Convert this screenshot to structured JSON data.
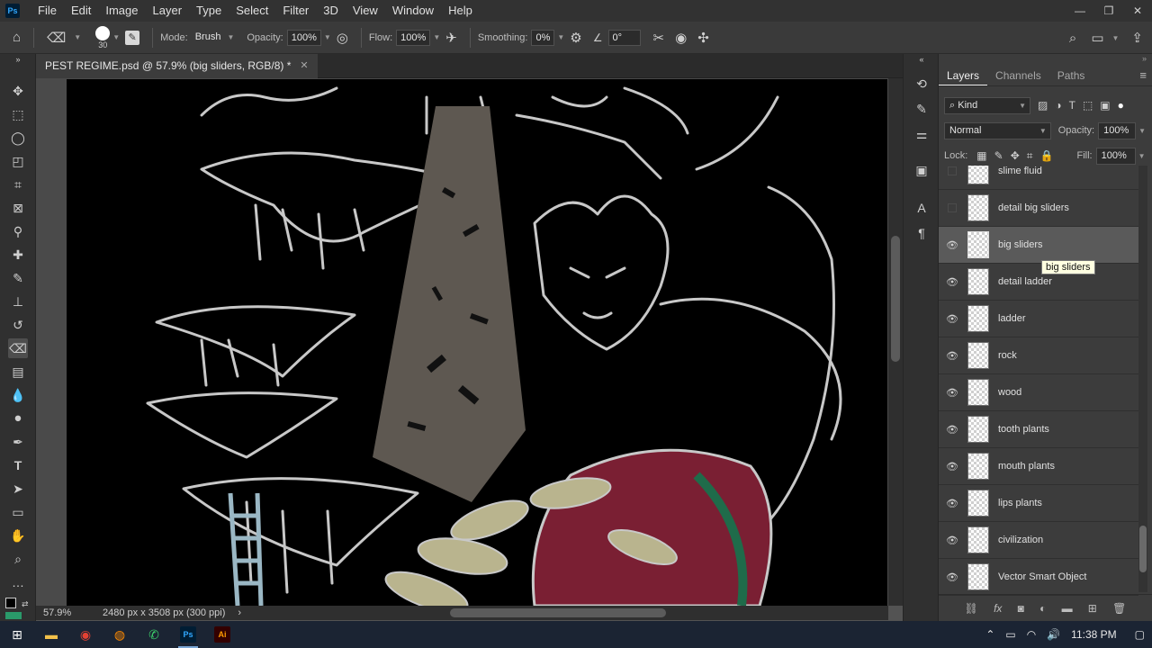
{
  "app": {
    "logo": "Ps"
  },
  "menu": [
    "File",
    "Edit",
    "Image",
    "Layer",
    "Type",
    "Select",
    "Filter",
    "3D",
    "View",
    "Window",
    "Help"
  ],
  "window_controls": {
    "minimize": "—",
    "restore": "❐",
    "close": "✕"
  },
  "options": {
    "brush_size": "30",
    "mode_label": "Mode:",
    "mode_value": "Brush",
    "opacity_label": "Opacity:",
    "opacity_value": "100%",
    "flow_label": "Flow:",
    "flow_value": "100%",
    "smoothing_label": "Smoothing:",
    "smoothing_value": "0%",
    "angle_value": "0°"
  },
  "document": {
    "tab_title": "PEST REGIME.psd @ 57.9% (big sliders, RGB/8) *",
    "close": "✕"
  },
  "status": {
    "zoom": "57.9%",
    "info": "2480 px x 3508 px (300 ppi)",
    "arrow": "›"
  },
  "layers_panel": {
    "tabs": [
      "Layers",
      "Channels",
      "Paths"
    ],
    "active_tab": 0,
    "menu_icon": "≡",
    "filter_kind": "Kind",
    "blend_mode": "Normal",
    "opacity_label": "Opacity:",
    "opacity_value": "100%",
    "lock_label": "Lock:",
    "fill_label": "Fill:",
    "fill_value": "100%",
    "layers": [
      {
        "name": "slime fluid",
        "visible": false
      },
      {
        "name": "detail big sliders",
        "visible": false
      },
      {
        "name": "big sliders",
        "visible": true,
        "selected": true
      },
      {
        "name": "detail ladder",
        "visible": true
      },
      {
        "name": "ladder",
        "visible": true
      },
      {
        "name": "rock",
        "visible": true
      },
      {
        "name": "wood",
        "visible": true
      },
      {
        "name": "tooth plants",
        "visible": true
      },
      {
        "name": "mouth plants",
        "visible": true
      },
      {
        "name": "lips plants",
        "visible": true
      },
      {
        "name": "civilization",
        "visible": true
      },
      {
        "name": "Vector Smart Object",
        "visible": true
      }
    ],
    "tooltip": "big sliders",
    "bottom_icons": [
      "link-icon",
      "fx-icon",
      "mask-icon",
      "adjustment-icon",
      "group-icon",
      "new-layer-icon",
      "trash-icon"
    ]
  },
  "taskbar": {
    "time": "11:38 PM"
  },
  "colors": {
    "accent": "#31a8ff",
    "canvas": "#000000",
    "panel": "#3c3c3c"
  }
}
